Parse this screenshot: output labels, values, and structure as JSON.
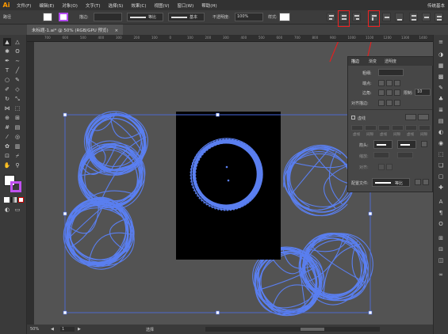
{
  "app": {
    "logo": "Ai",
    "workspace": "传统基本"
  },
  "menu": [
    "文件(F)",
    "编辑(E)",
    "对象(O)",
    "文字(T)",
    "选择(S)",
    "效果(C)",
    "视图(V)",
    "窗口(W)",
    "帮助(H)"
  ],
  "control_bar": {
    "selection_label": "路径",
    "stroke_label": "描边:",
    "stroke_profile": "等比",
    "brush": "基本",
    "opacity_label": "不透明度:",
    "opacity_value": "100%",
    "style_label": "样式:"
  },
  "document_tab": {
    "title": "未标题-1.ai* @ 50% (RGB/GPU 预览)",
    "close": "×"
  },
  "ruler_ticks": [
    "700",
    "600",
    "500",
    "400",
    "300",
    "200",
    "100",
    "0",
    "100",
    "200",
    "300",
    "400",
    "500",
    "600",
    "700",
    "800",
    "900",
    "1000",
    "1100",
    "1200",
    "1300",
    "1400"
  ],
  "status_bar": {
    "zoom": "50%",
    "page": "1",
    "mode": "选择"
  },
  "panel": {
    "tabs": [
      "描边",
      "渐变",
      "透明度"
    ],
    "weight_label": "粗细:",
    "cap_label": "端点:",
    "corner_label": "边角:",
    "limit_label": "限制:",
    "limit_value": "10",
    "align_stroke_label": "对齐描边:",
    "dashed_label": "虚线",
    "dash_fields": [
      "虚线",
      "间隙",
      "虚线",
      "间隙",
      "虚线",
      "间隙"
    ],
    "arrow_label": "箭头:",
    "scale_label": "缩放:",
    "align_label": "对齐:",
    "profile_label": "配置文件:",
    "profile_value": "等比"
  },
  "colors": {
    "accent": "#ff9a00",
    "stroke_blue": "#5a7ff0",
    "artboard": "#000000",
    "annotation": "#e02020",
    "selection": "#4b6eea"
  }
}
